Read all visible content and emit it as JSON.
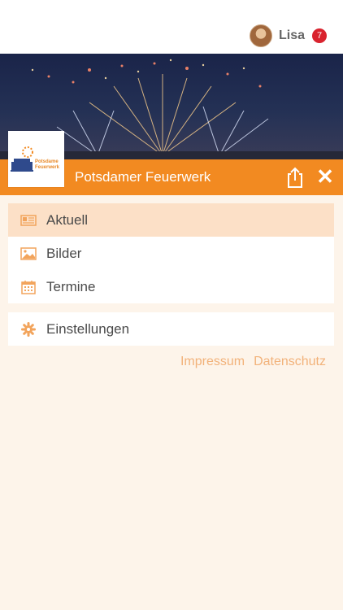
{
  "user": {
    "name": "Lisa",
    "badge_count": "7"
  },
  "header": {
    "title": "Potsdamer Feuerwerk"
  },
  "logo": {
    "line1": "Potsdame",
    "line2": "Feuerwerk"
  },
  "menu": {
    "items": [
      {
        "label": "Aktuell",
        "icon": "newspaper-icon",
        "active": true
      },
      {
        "label": "Bilder",
        "icon": "image-icon",
        "active": false
      },
      {
        "label": "Termine",
        "icon": "calendar-icon",
        "active": false
      }
    ],
    "settings": {
      "label": "Einstellungen",
      "icon": "gear-icon"
    }
  },
  "footer": {
    "impressum": "Impressum",
    "datenschutz": "Datenschutz"
  },
  "colors": {
    "accent": "#F28A21",
    "icon": "#F2A45C",
    "background": "#FDF4EA",
    "active_row": "#FCE0C7"
  }
}
